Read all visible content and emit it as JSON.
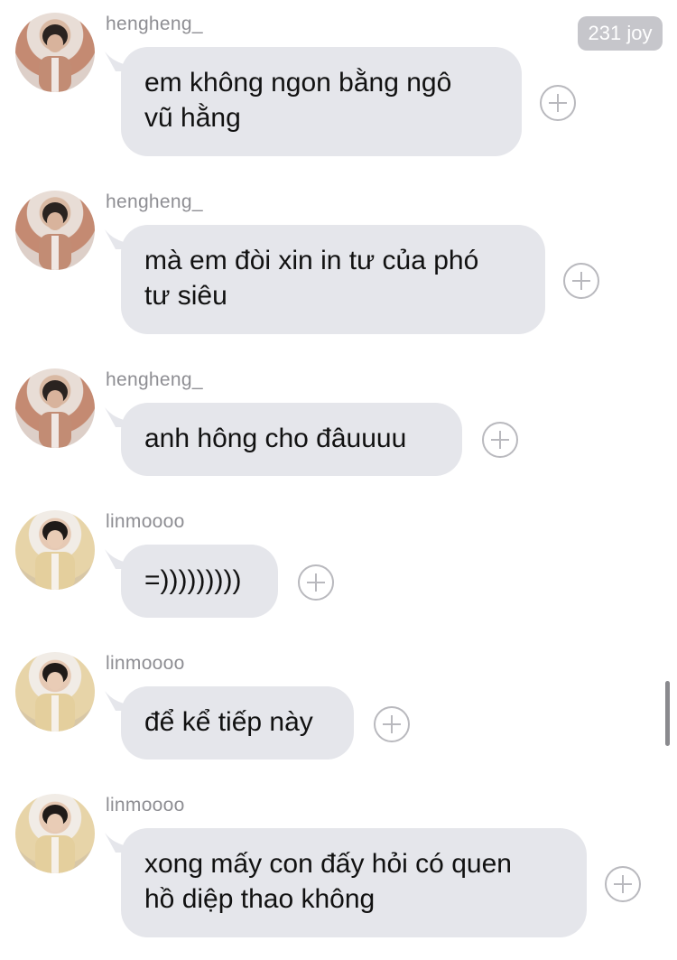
{
  "badge": "231 joy",
  "messages": [
    {
      "sender": "hengheng_",
      "avatar": "user-avatar",
      "lines": [
        "em không ngon bằng ngô",
        "vũ hằng"
      ]
    },
    {
      "sender": "hengheng_",
      "avatar": "user-avatar",
      "lines": [
        "mà em đòi xin in tư của phó",
        "tư siêu"
      ]
    },
    {
      "sender": "hengheng_",
      "avatar": "user-avatar",
      "lines": [
        "anh hông cho đâuuuu"
      ]
    },
    {
      "sender": "linmoooo",
      "avatar": "user-avatar",
      "lines": [
        "=)))))))))"
      ]
    },
    {
      "sender": "linmoooo",
      "avatar": "user-avatar",
      "lines": [
        "để kể tiếp này"
      ]
    },
    {
      "sender": "linmoooo",
      "avatar": "user-avatar",
      "lines": [
        "xong mấy con đấy hỏi có quen",
        "hồ diệp thao không"
      ]
    }
  ],
  "icons": {
    "react": "plus-circle-icon"
  }
}
